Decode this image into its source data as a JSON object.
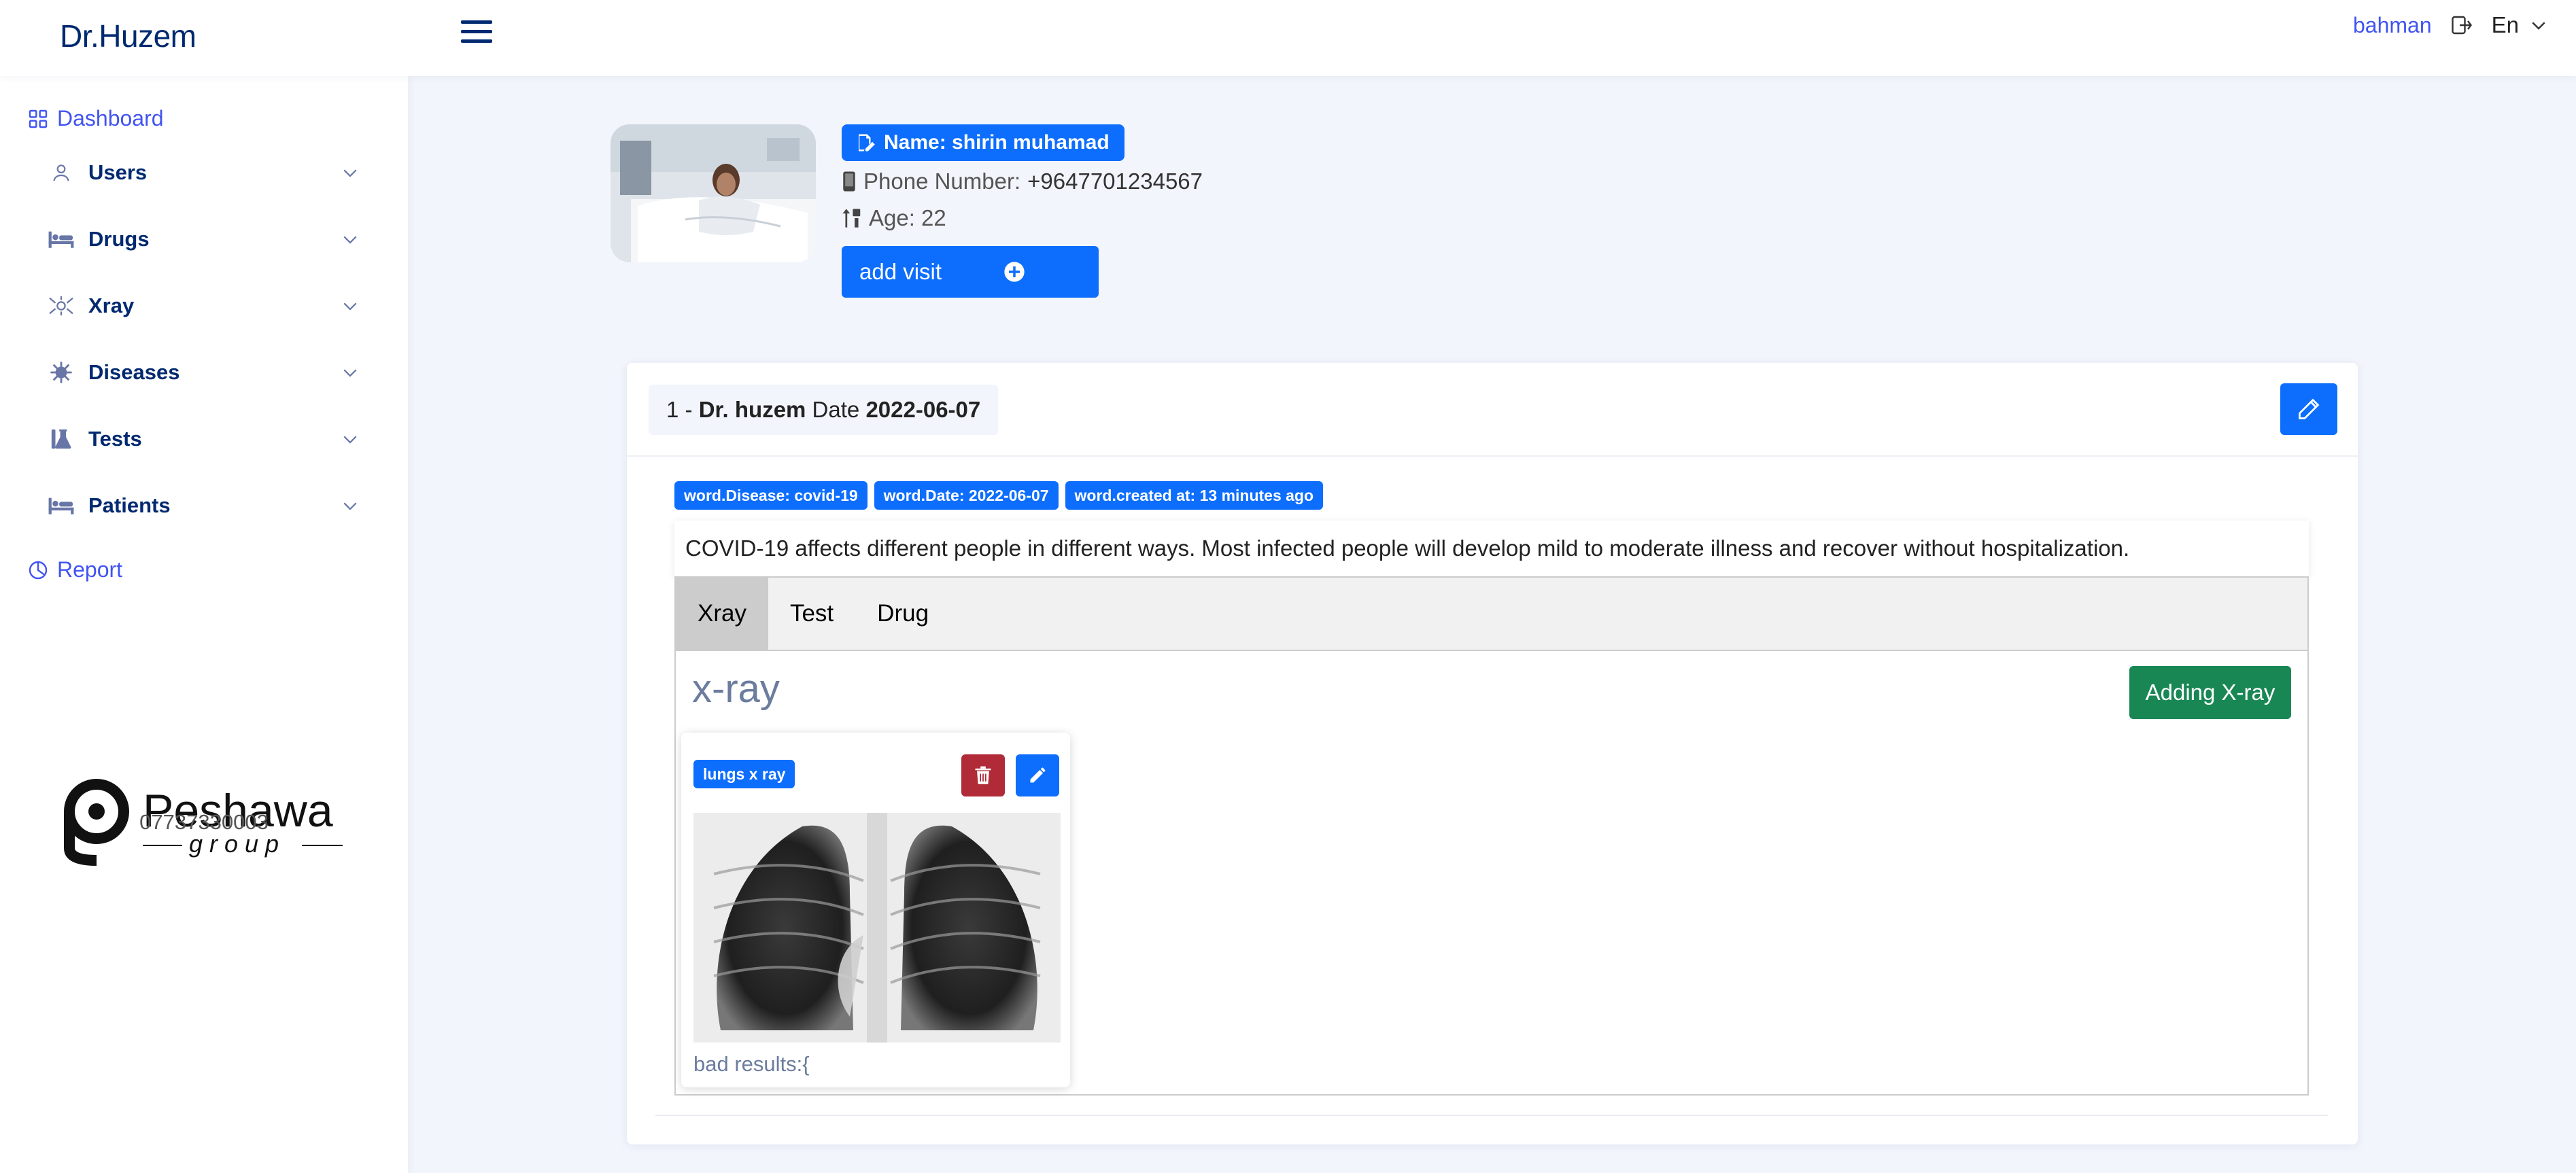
{
  "header": {
    "brand": "Dr.Huzem",
    "username": "bahman",
    "language": "En"
  },
  "sidebar": {
    "dashboard": "Dashboard",
    "items": [
      {
        "label": "Users",
        "icon": "person-icon"
      },
      {
        "label": "Drugs",
        "icon": "bed-icon"
      },
      {
        "label": "Xray",
        "icon": "virus-icon"
      },
      {
        "label": "Diseases",
        "icon": "virus-gear-icon"
      },
      {
        "label": "Tests",
        "icon": "flask-icon"
      },
      {
        "label": "Patients",
        "icon": "bed-icon"
      }
    ],
    "report": "Report",
    "logo_text": "Peshawa",
    "logo_sub": "group",
    "phone": "07737330003"
  },
  "patient": {
    "name": "Name: shirin muhamad",
    "phone_label": "Phone Number:",
    "phone_value": "+9647701234567",
    "age": "Age: 22",
    "add_visit": "add visit"
  },
  "visit": {
    "number": "1 - ",
    "doctor": "Dr. huzem",
    "date_label": " Date ",
    "date": "2022-06-07",
    "badges": [
      "word.Disease: covid-19",
      "word.Date: 2022-06-07",
      "word.created at: 13 minutes ago"
    ],
    "description": "COVID-19 affects different people in different ways. Most infected people will develop mild to moderate illness and recover without hospitalization.",
    "tabs": [
      "Xray",
      "Test",
      "Drug"
    ],
    "active_tab": "Xray",
    "section_title": "x-ray",
    "add_xray": "Adding X-ray",
    "xray_card": {
      "tag": "lungs x ray",
      "note": "bad results:{"
    }
  },
  "colors": {
    "primary": "#0d6efd",
    "brand_navy": "#012970",
    "link": "#4154f1",
    "success": "#198754",
    "danger": "#b02a37",
    "page_bg": "#f3f5fc"
  }
}
